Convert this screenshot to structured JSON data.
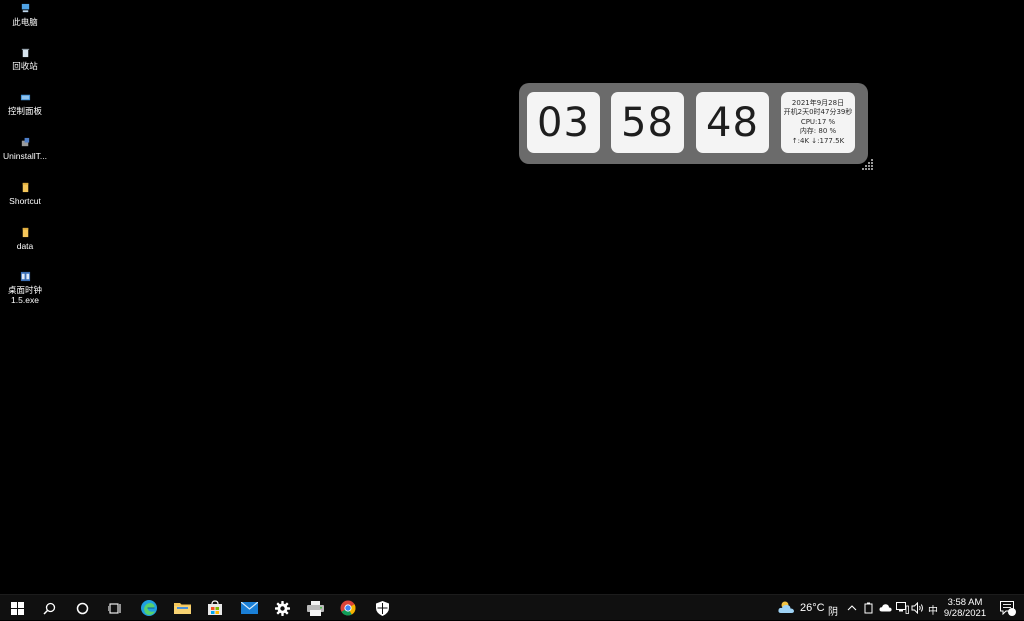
{
  "desktop": {
    "icons": [
      {
        "label": "此电脑",
        "icon": "computer-icon"
      },
      {
        "label": "回收站",
        "icon": "recycle-bin-icon"
      },
      {
        "label": "控制面板",
        "icon": "control-panel-icon"
      },
      {
        "label": "UninstallT...",
        "icon": "uninstall-tool-icon"
      },
      {
        "label": "Shortcut",
        "icon": "folder-icon"
      },
      {
        "label": "data",
        "icon": "folder-icon"
      },
      {
        "label": "桌面时钟\n1.5.exe",
        "icon": "clock-app-icon"
      }
    ]
  },
  "clock": {
    "hours": "03",
    "minutes": "58",
    "seconds": "48",
    "info": {
      "date": "2021年9月28日",
      "uptime": "开机2天0时47分39秒",
      "cpu": "CPU:17 %",
      "memory": "内存: 80 %",
      "network": "↑:4K ↓:177.5K"
    }
  },
  "taskbar": {
    "pinned": [
      {
        "name": "edge",
        "icon": "edge-icon"
      },
      {
        "name": "file-explorer",
        "icon": "folder-icon"
      },
      {
        "name": "store",
        "icon": "store-bag-icon"
      },
      {
        "name": "mail",
        "icon": "mail-icon"
      },
      {
        "name": "settings",
        "icon": "gear-icon"
      },
      {
        "name": "printer",
        "icon": "printer-icon"
      },
      {
        "name": "chrome",
        "icon": "chrome-icon"
      },
      {
        "name": "security",
        "icon": "shield-icon"
      }
    ],
    "tray": {
      "weather_temp": "26°C",
      "weather_cond": "阴",
      "ime": "中",
      "time": "3:58 AM",
      "date": "9/28/2021"
    }
  },
  "colors": {
    "desktop_bg": "#000000",
    "taskbar_bg": "#101010",
    "widget_frame": "#6b6b6b",
    "card_bg": "#f4f4f4",
    "edge_accent": "#1f9fe0",
    "folder_yellow": "#f5c65a"
  }
}
